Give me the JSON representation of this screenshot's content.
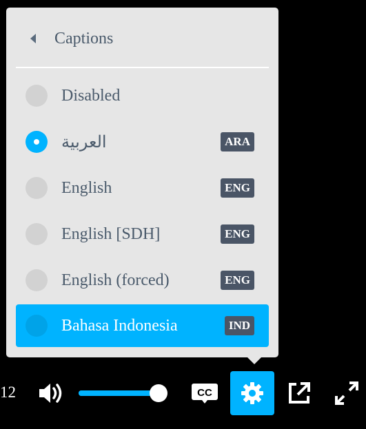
{
  "menu": {
    "title": "Captions",
    "options": [
      {
        "label": "Disabled",
        "badge": "",
        "checked": false,
        "active": false
      },
      {
        "label": "العربية",
        "badge": "ARA",
        "checked": true,
        "active": false
      },
      {
        "label": "English",
        "badge": "ENG",
        "checked": false,
        "active": false
      },
      {
        "label": "English [SDH]",
        "badge": "ENG",
        "checked": false,
        "active": false
      },
      {
        "label": "English (forced)",
        "badge": "ENG",
        "checked": false,
        "active": false
      },
      {
        "label": "Bahasa Indonesia",
        "badge": "IND",
        "checked": false,
        "active": true
      }
    ]
  },
  "controls": {
    "time": "12",
    "volume_level": 0.95,
    "icons": [
      "volume-icon",
      "captions-icon",
      "settings-icon",
      "popout-icon",
      "fullscreen-icon"
    ],
    "accent_color": "#00b3ff"
  }
}
